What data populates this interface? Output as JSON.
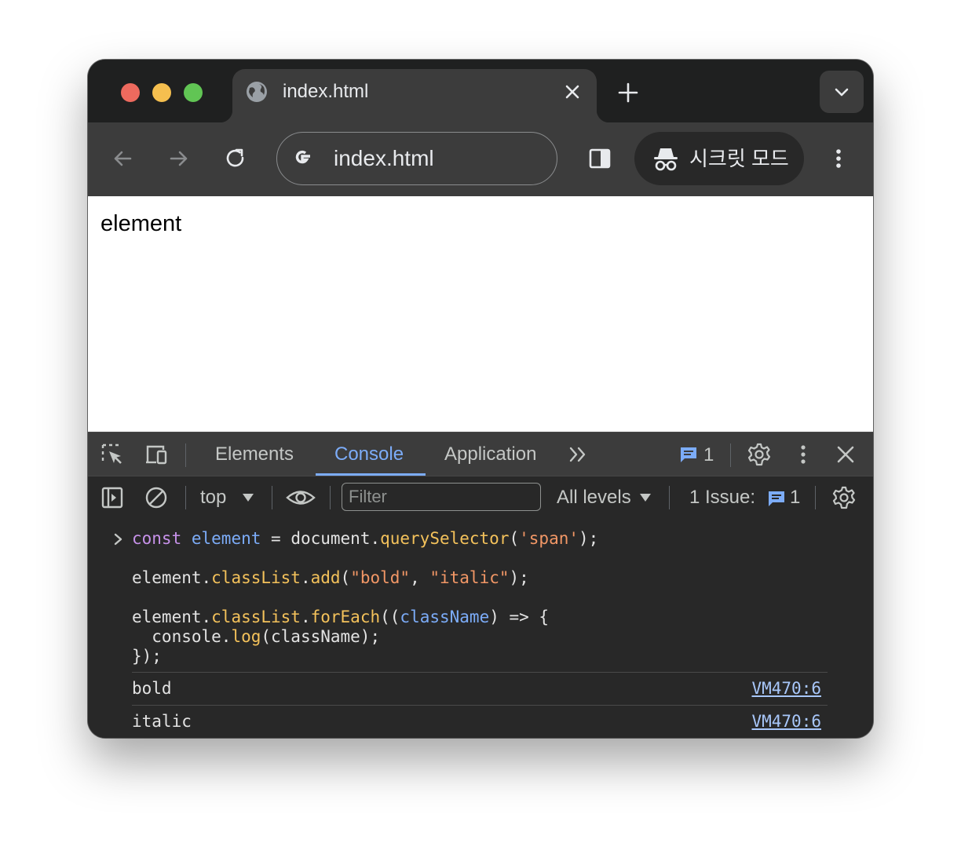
{
  "window": {
    "tab": {
      "title": "index.html",
      "icon": "globe-icon"
    },
    "address_bar": {
      "value": "index.html",
      "icon": "google-icon"
    },
    "incognito_label": "시크릿 모드"
  },
  "page": {
    "text": "element"
  },
  "devtools": {
    "tabs": [
      "Elements",
      "Console",
      "Application"
    ],
    "active_tab": "Console",
    "issues_badge": "1",
    "console_toolbar": {
      "context": "top",
      "filter_placeholder": "Filter",
      "levels": "All levels",
      "issues_label": "1 Issue:",
      "issues_count": "1"
    }
  },
  "console": {
    "code": [
      [
        [
          "kw",
          "const"
        ],
        [
          "p",
          " "
        ],
        [
          "var",
          "element"
        ],
        [
          "p",
          " = document."
        ],
        [
          "fn",
          "querySelector"
        ],
        [
          "p",
          "("
        ],
        [
          "str",
          "'span'"
        ],
        [
          "p",
          ");"
        ]
      ],
      [
        [
          "p",
          "element."
        ],
        [
          "fn",
          "classList"
        ],
        [
          "p",
          "."
        ],
        [
          "fn",
          "add"
        ],
        [
          "p",
          "("
        ],
        [
          "str",
          "\"bold\""
        ],
        [
          "p",
          ", "
        ],
        [
          "str",
          "\"italic\""
        ],
        [
          "p",
          ");"
        ]
      ],
      [
        [
          "p",
          "element."
        ],
        [
          "fn",
          "classList"
        ],
        [
          "p",
          "."
        ],
        [
          "fn",
          "forEach"
        ],
        [
          "p",
          "(("
        ],
        [
          "var",
          "className"
        ],
        [
          "p",
          ") => {"
        ]
      ],
      [
        [
          "p",
          "  console."
        ],
        [
          "fn",
          "log"
        ],
        [
          "p",
          "(className);"
        ]
      ],
      [
        [
          "p",
          "});"
        ]
      ]
    ],
    "outputs": [
      {
        "text": "bold",
        "source": "VM470:6"
      },
      {
        "text": "italic",
        "source": "VM470:6"
      }
    ]
  },
  "colors": {
    "accent": "#7cacf8",
    "keyword": "#c792ea",
    "function": "#f4c25b",
    "string": "#f29766",
    "link": "#a8c7fa"
  }
}
